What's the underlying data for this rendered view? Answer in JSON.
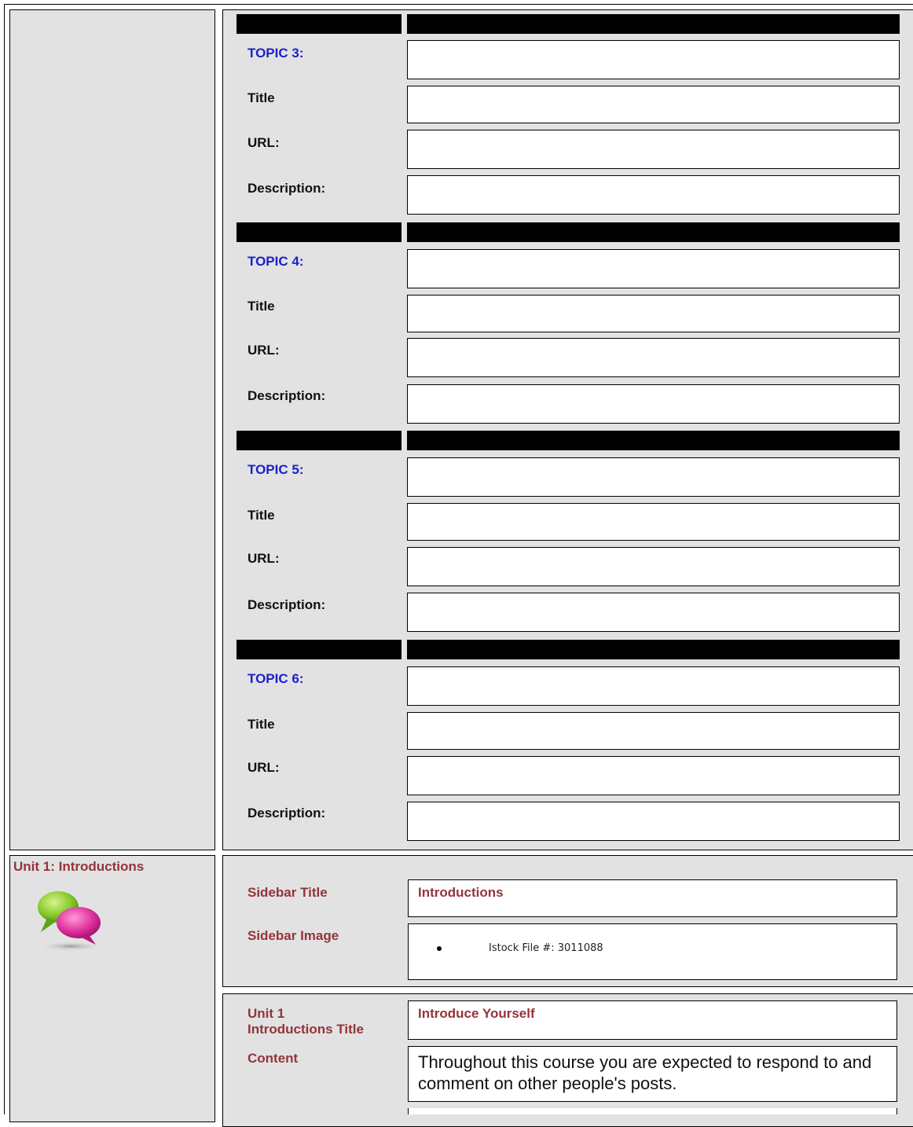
{
  "topics": [
    {
      "heading": "TOPIC 3:",
      "title_label": "Title",
      "url_label": "URL:",
      "description_label": "Description:"
    },
    {
      "heading": "TOPIC 4:",
      "title_label": "Title",
      "url_label": "URL:",
      "description_label": "Description:"
    },
    {
      "heading": "TOPIC 5:",
      "title_label": "Title",
      "url_label": "URL:",
      "description_label": "Description:"
    },
    {
      "heading": "TOPIC 6:",
      "title_label": "Title",
      "url_label": "URL:",
      "description_label": "Description:"
    }
  ],
  "unit": {
    "heading": "Unit 1: Introductions",
    "icon": "speech-bubbles-icon",
    "sidebar_title_label": "Sidebar Title",
    "sidebar_title_value": "Introductions",
    "sidebar_image_label": "Sidebar Image",
    "sidebar_image_items": [
      "Istock File #: 3011088"
    ],
    "unit_title_label_line1": "Unit 1",
    "unit_title_label_line2": "Introductions Title",
    "unit_title_value": "Introduce Yourself",
    "content_label": "Content",
    "content_value": "Throughout this course you are expected to respond to and comment on other people's posts."
  },
  "colors": {
    "topic_heading": "#1a22c8",
    "unit_label": "#93343a",
    "panel_background": "#e2e2e2"
  }
}
